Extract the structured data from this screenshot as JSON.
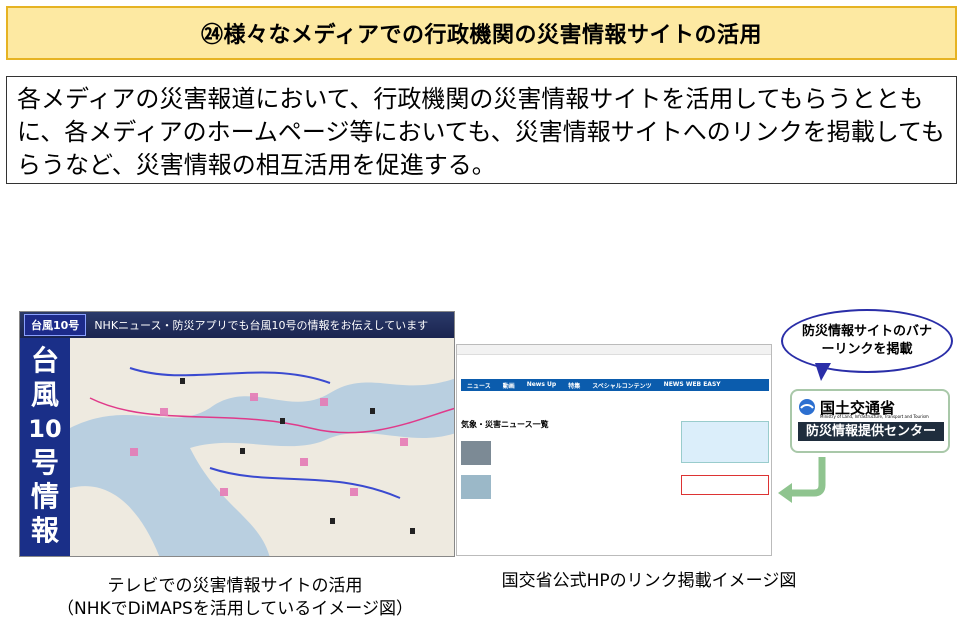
{
  "title": "㉔様々なメディアでの行政機関の災害情報サイトの活用",
  "description": "各メディアの災害報道において、行政機関の災害情報サイトを活用してもらうとともに、各メディアのホームページ等においても、災害情報サイトへのリンクを掲載してもらうなど、災害情報の相互活用を促進する。",
  "tv_image": {
    "ticker_badge": "台風10号",
    "ticker_text": "NHKニュース・防災アプリでも台風10号の情報をお伝えしています",
    "side_label": [
      "台",
      "風",
      "10",
      "号",
      "情",
      "報"
    ]
  },
  "web_image": {
    "nav_items": [
      "ニュース",
      "動画",
      "News Up",
      "特集",
      "スペシャルコンテンツ",
      "NEWS WEB EASY"
    ],
    "section_title": "気象・災害ニュース一覧"
  },
  "callout": "防災情報サイトのバナーリンクを掲載",
  "banner": {
    "org": "国土交通省",
    "org_en": "Ministry of Land, Infrastructure, Transport and Tourism",
    "center": "防災情報提供センター"
  },
  "captions": {
    "left_line1": "テレビでの災害情報サイトの活用",
    "left_line2": "（NHKでDiMAPSを活用しているイメージ図）",
    "right": "国交省公式HPのリンク掲載イメージ図"
  }
}
